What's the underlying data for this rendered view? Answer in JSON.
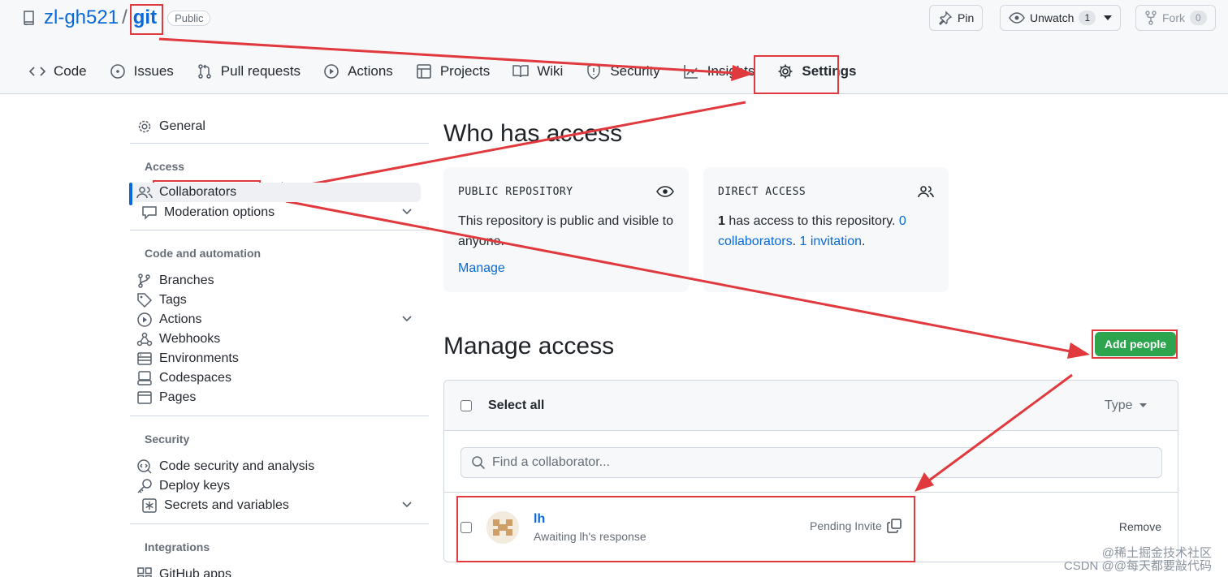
{
  "repo": {
    "owner": "zl-gh521",
    "slash": "/",
    "name": "git",
    "visibility": "Public"
  },
  "header_actions": {
    "pin_label": "Pin",
    "unwatch_label": "Unwatch",
    "unwatch_count": "1",
    "fork_label": "Fork",
    "fork_count": "0"
  },
  "tabs": [
    {
      "label": "Code",
      "icon": "code-icon"
    },
    {
      "label": "Issues",
      "icon": "issue-icon"
    },
    {
      "label": "Pull requests",
      "icon": "pull-request-icon"
    },
    {
      "label": "Actions",
      "icon": "play-icon"
    },
    {
      "label": "Projects",
      "icon": "table-icon"
    },
    {
      "label": "Wiki",
      "icon": "book-icon"
    },
    {
      "label": "Security",
      "icon": "shield-icon"
    },
    {
      "label": "Insights",
      "icon": "graph-icon"
    },
    {
      "label": "Settings",
      "icon": "gear-icon"
    }
  ],
  "sidebar": {
    "general": "General",
    "access_heading": "Access",
    "collaborators": "Collaborators",
    "moderation": "Moderation options",
    "code_heading": "Code and automation",
    "branches": "Branches",
    "tags": "Tags",
    "actions": "Actions",
    "webhooks": "Webhooks",
    "environments": "Environments",
    "codespaces": "Codespaces",
    "pages": "Pages",
    "security_heading": "Security",
    "code_security": "Code security and analysis",
    "deploy_keys": "Deploy keys",
    "secrets": "Secrets and variables",
    "integrations_heading": "Integrations",
    "github_apps": "GitHub apps"
  },
  "who_has_access": {
    "title": "Who has access",
    "public_card": {
      "heading": "PUBLIC REPOSITORY",
      "text": "This repository is public and visible to anyone.",
      "link": "Manage"
    },
    "direct_card": {
      "heading": "DIRECT ACCESS",
      "count": "1",
      "text_mid": " has access to this repository. ",
      "collaborators_link": "0 collaborators",
      "sep": ". ",
      "invitation_link": "1 invitation",
      "end": "."
    }
  },
  "manage_access": {
    "title": "Manage access",
    "add_people": "Add people",
    "select_all": "Select all",
    "type_filter": "Type",
    "search_placeholder": "Find a collaborator...",
    "member": {
      "name": "lh",
      "status": "Awaiting lh's response",
      "pending": "Pending Invite",
      "remove": "Remove"
    }
  },
  "watermark": {
    "line1": "@稀土掘金技术社区",
    "line2": "CSDN @@每天都要敲代码"
  },
  "colors": {
    "annotation_red": "#e0393e",
    "primary_green": "#2da44e",
    "link_blue": "#0969da"
  }
}
